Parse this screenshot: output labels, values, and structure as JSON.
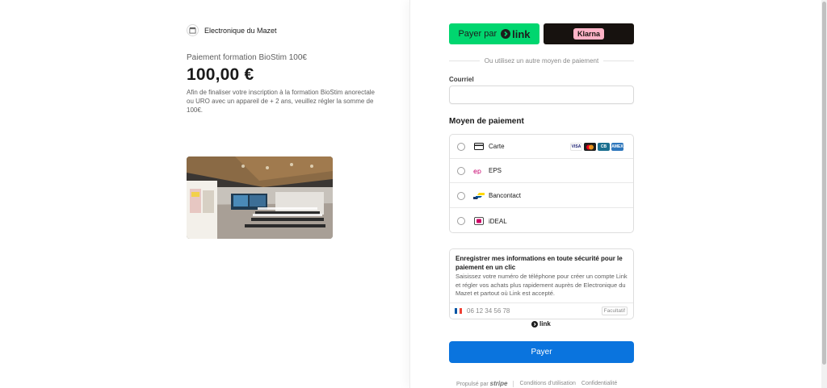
{
  "merchant": {
    "name": "Electronique du Mazet",
    "logo_icon": "store-icon"
  },
  "product": {
    "name": "Paiement formation BioStim 100€",
    "amount": "100,00 €",
    "description": "Afin de finaliser votre inscription à la formation BioStim anorectale ou URO avec un appareil de + 2 ans, veuillez régler la somme de 100€."
  },
  "express": {
    "link_prefix": "Payer par",
    "link_brand": "link",
    "klarna_brand": "Klarna",
    "link_color": "#00d66f",
    "klarna_bg": "#17120f",
    "klarna_badge": "#ffb3c7"
  },
  "divider_text": "Ou utilisez un autre moyen de paiement",
  "email": {
    "label": "Courriel",
    "value": "",
    "placeholder": ""
  },
  "payment_methods": {
    "title": "Moyen de paiement",
    "items": [
      {
        "label": "Carte",
        "icon": "credit-card-icon"
      },
      {
        "label": "EPS",
        "icon": "eps-icon"
      },
      {
        "label": "Bancontact",
        "icon": "bancontact-icon"
      },
      {
        "label": "iDEAL",
        "icon": "ideal-icon"
      }
    ],
    "card_brands": [
      "VISA",
      "MC",
      "CB",
      "AMEX"
    ]
  },
  "link_save": {
    "title": "Enregistrer mes informations en toute sécurité pour le paiement en un clic",
    "text": "Saisissez votre numéro de téléphone pour créer un compte Link et régler vos achats plus rapidement auprès de Electronique du Mazet et partout où Link est accepté.",
    "phone_placeholder": "06 12 34 56 78",
    "optional_label": "Facultatif",
    "footer_brand": "link"
  },
  "pay_button": {
    "label": "Payer",
    "color": "#0a74de"
  },
  "footer": {
    "powered_by": "Propulsé par",
    "brand": "stripe",
    "terms": "Conditions d'utilisation",
    "privacy": "Confidentialité"
  }
}
